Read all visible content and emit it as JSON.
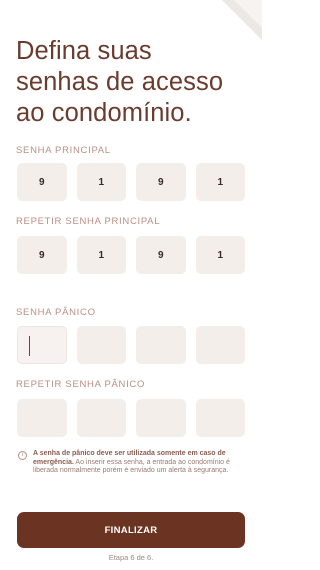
{
  "title_lines": [
    "Defina suas",
    "senhas de acesso",
    "ao condomínio."
  ],
  "labels": {
    "main": "SENHA PRINCIPAL",
    "repeat_main": "REPETIR SENHA PRINCIPAL",
    "panic": "SENHA PÂNICO",
    "repeat_panic": "REPETIR SENHA PÂNICO"
  },
  "main_password": [
    "9",
    "1",
    "9",
    "1"
  ],
  "repeat_main_password": [
    "9",
    "1",
    "9",
    "1"
  ],
  "panic_password": [
    "",
    "",
    "",
    ""
  ],
  "repeat_panic_password": [
    "",
    "",
    "",
    ""
  ],
  "info": {
    "icon": "info-icon",
    "bold": "A senha de pânico deve ser utilizada somente em caso de emergência.",
    "text": " Ao inserir essa senha, a entrada ao condomínio é liberada normalmente porém é enviado um alerta à segurança."
  },
  "finish_label": "FINALIZAR",
  "step_text": "Etapa 6 de 6.",
  "colors": {
    "accent": "#6b3422",
    "title": "#6b3b2e",
    "box": "#f4eeea"
  }
}
